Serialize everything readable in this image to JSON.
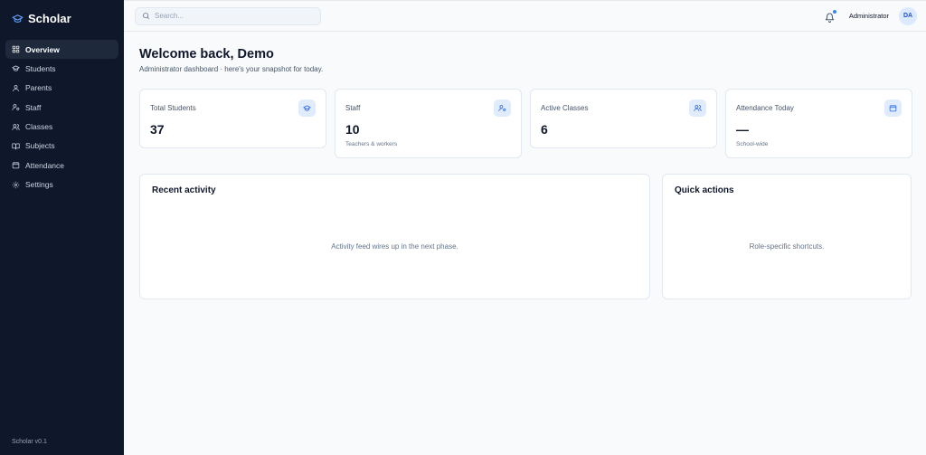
{
  "brand": {
    "name": "Scholar"
  },
  "sidebar": {
    "items": [
      {
        "label": "Overview",
        "icon": "grid-icon",
        "active": true
      },
      {
        "label": "Students",
        "icon": "graduation-cap-icon"
      },
      {
        "label": "Parents",
        "icon": "user-icon"
      },
      {
        "label": "Staff",
        "icon": "user-cog-icon"
      },
      {
        "label": "Classes",
        "icon": "users-icon"
      },
      {
        "label": "Subjects",
        "icon": "book-icon"
      },
      {
        "label": "Attendance",
        "icon": "calendar-icon"
      },
      {
        "label": "Settings",
        "icon": "gear-icon"
      }
    ],
    "version": "Scholar v0.1"
  },
  "header": {
    "search_placeholder": "Search...",
    "role": "Administrator",
    "avatar_initials": "DA"
  },
  "main": {
    "title": "Welcome back, Demo",
    "subtitle": "Administrator dashboard · here's your snapshot for today.",
    "stats": [
      {
        "label": "Total Students",
        "value": "37",
        "note": "",
        "icon": "graduation-cap-icon"
      },
      {
        "label": "Staff",
        "value": "10",
        "note": "Teachers & workers",
        "icon": "user-cog-icon"
      },
      {
        "label": "Active Classes",
        "value": "6",
        "note": "",
        "icon": "users-icon"
      },
      {
        "label": "Attendance Today",
        "value": "—",
        "note": "School-wide",
        "icon": "calendar-icon"
      }
    ],
    "recent_activity": {
      "title": "Recent activity",
      "empty": "Activity feed wires up in the next phase."
    },
    "quick_actions": {
      "title": "Quick actions",
      "empty": "Role-specific shortcuts."
    }
  },
  "colors": {
    "sidebar_bg": "#0f172a",
    "accent": "#3b82f6",
    "page_bg": "#f8fafc"
  }
}
